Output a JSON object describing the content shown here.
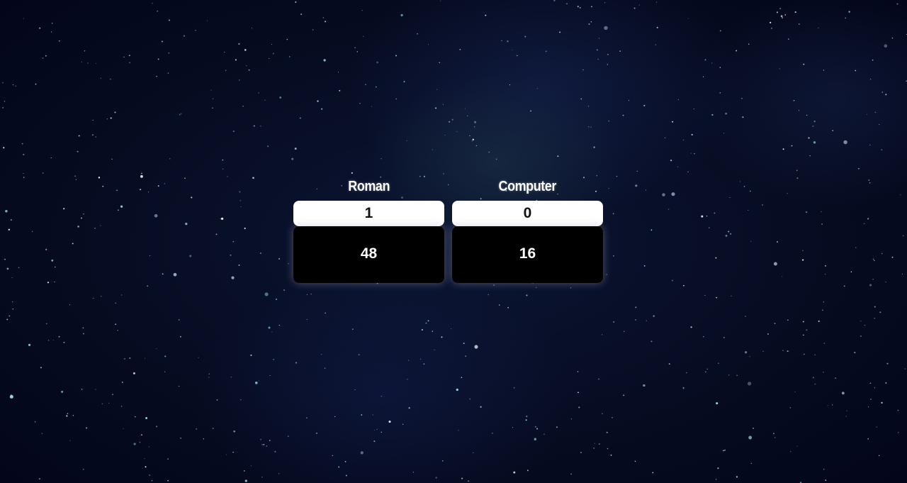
{
  "players": [
    {
      "name": "Roman",
      "score": "1",
      "points": "48"
    },
    {
      "name": "Computer",
      "score": "0",
      "points": "16"
    }
  ],
  "colors": {
    "background": "#060b20",
    "score_box": "#ffffff",
    "points_box": "#000000",
    "text_light": "#ffffff",
    "text_dark": "#111111"
  }
}
